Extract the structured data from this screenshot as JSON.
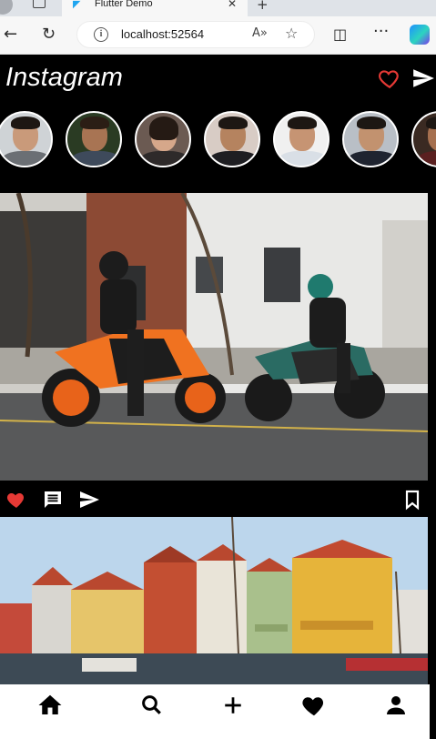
{
  "browser": {
    "tab_title": "Flutter Demo",
    "url": "localhost:52564"
  },
  "app": {
    "title": "Instagram",
    "accent": "#e53935"
  },
  "stories": [
    {
      "name": "story-1"
    },
    {
      "name": "story-2"
    },
    {
      "name": "story-3"
    },
    {
      "name": "story-4"
    },
    {
      "name": "story-5"
    },
    {
      "name": "story-6"
    },
    {
      "name": "story-7"
    }
  ],
  "post2_sign": {
    "left": "HJ ERING",
    "right": "NYHAVN 17"
  },
  "bottom_nav": {
    "home_label": "Home"
  }
}
